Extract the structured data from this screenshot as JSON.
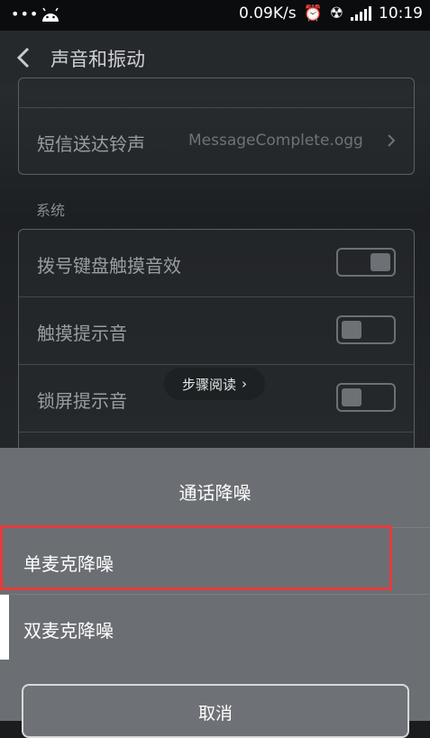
{
  "status_bar": {
    "dots": "•••",
    "net_speed": "0.09K/s",
    "time": "10:19",
    "icons": [
      "android-icon",
      "alarm-icon",
      "sync-icon",
      "signal-icon"
    ]
  },
  "header": {
    "title": "声音和振动",
    "back_icon": "chevron-left-icon"
  },
  "card1": {
    "rows": [
      {
        "label": "短信送达铃声",
        "value": "MessageComplete.ogg"
      }
    ]
  },
  "section": {
    "label": "系统"
  },
  "card2": {
    "rows": [
      {
        "label": "拨号键盘触摸音效",
        "toggle": "on"
      },
      {
        "label": "触摸提示音",
        "toggle": "off"
      },
      {
        "label": "锁屏提示音",
        "toggle": "off"
      }
    ]
  },
  "tooltip": {
    "text": "步骤阅读",
    "arrow": "›"
  },
  "sheet": {
    "title": "通话降噪",
    "options": [
      {
        "label": "单麦克降噪",
        "selected": false
      },
      {
        "label": "双麦克降噪",
        "selected": true
      }
    ],
    "cancel": "取消"
  },
  "colors": {
    "highlight": "#e53b3b",
    "sheet_bg": "#6b6e72"
  }
}
